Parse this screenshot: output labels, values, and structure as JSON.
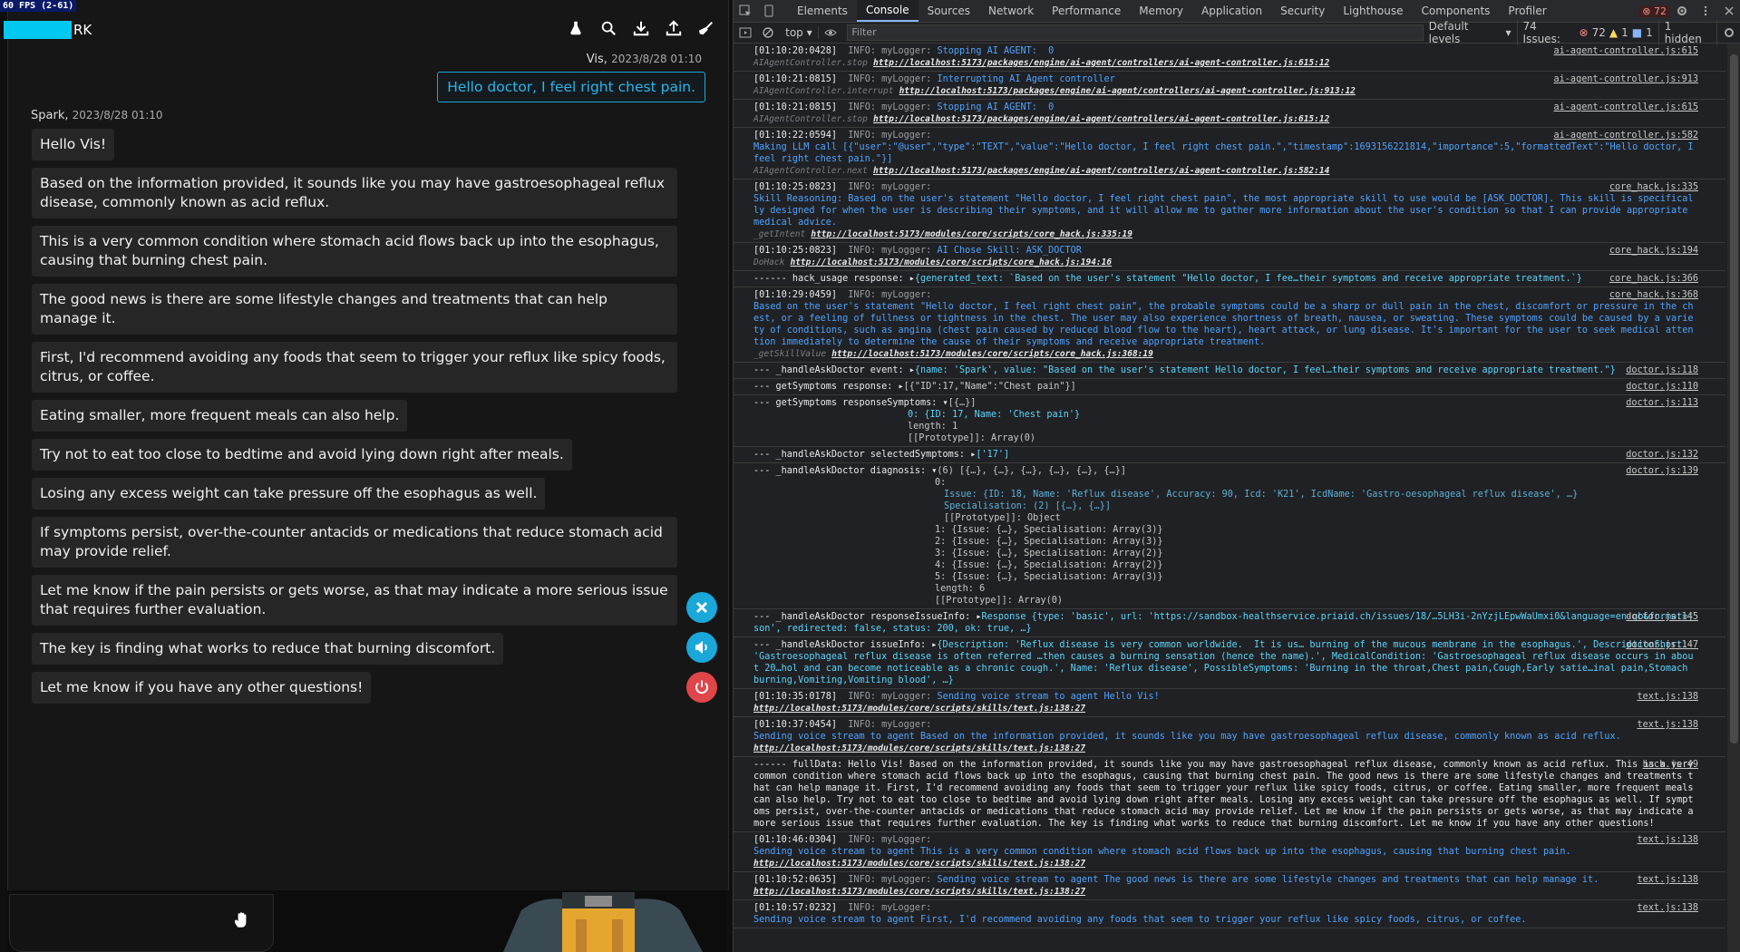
{
  "chat": {
    "fps": "60 FPS (2-61)",
    "brand_suffix": "RK",
    "user_name": "Vis,",
    "user_time": "2023/8/28 01:10",
    "user_message": "Hello doctor, I feel right chest pain.",
    "bot_name": "Spark,",
    "bot_time": "2023/8/28 01:10",
    "messages": [
      "Hello Vis!",
      "Based on the information provided, it sounds like you may have gastroesophageal reflux disease, commonly known as acid reflux.",
      "This is a very common condition where stomach acid flows back up into the esophagus, causing that burning chest pain.",
      "The good news is there are some lifestyle changes and treatments that can help manage it.",
      "First, I'd recommend avoiding any foods that seem to trigger your reflux like spicy foods, citrus, or coffee.",
      "Eating smaller, more frequent meals can also help.",
      "Try not to eat too close to bedtime and avoid lying down right after meals.",
      "Losing any excess weight can take pressure off the esophagus as well.",
      "If symptoms persist, over-the-counter antacids or medications that reduce stomach acid may provide relief.",
      "Let me know if the pain persists or gets worse, as that may indicate a more serious issue that requires further evaluation.",
      "The key is finding what works to reduce that burning discomfort.",
      "Let me know if you have any other questions!"
    ],
    "icons": [
      "flask-icon",
      "search-icon",
      "download-icon",
      "upload-icon",
      "broom-icon"
    ],
    "colors": {
      "accent": "#1fa8d6",
      "close_fab": "#1aa7d9",
      "sound_fab": "#1aa7d9",
      "power_fab": "#e0454a"
    }
  },
  "devtools": {
    "tabs": [
      "Elements",
      "Console",
      "Sources",
      "Network",
      "Performance",
      "Memory",
      "Application",
      "Security",
      "Lighthouse",
      "Components",
      "Profiler"
    ],
    "active_tab": "Console",
    "error_count": "72",
    "context": "top",
    "filter_placeholder": "Filter",
    "levels": "Default levels",
    "issues_label": "74 Issues:",
    "issues_err": "72",
    "issues_warn": "1",
    "issues_info": "1",
    "hidden": "1 hidden",
    "logs": [
      {
        "ts": "[01:10:20:0428]",
        "tag": "INFO:",
        "logger": "myLogger:",
        "msg": "Stopping AI AGENT:  0",
        "stack": "AIAgentController.stop",
        "url": "http://localhost:5173/packages/engine/ai-agent/controllers/ai-agent-controller.js:615:12",
        "src": "ai-agent-controller.js:615"
      },
      {
        "ts": "[01:10:21:0815]",
        "tag": "INFO:",
        "logger": "myLogger:",
        "msg": "Interrupting AI Agent controller",
        "stack": "AIAgentController.interrupt",
        "url": "http://localhost:5173/packages/engine/ai-agent/controllers/ai-agent-controller.js:913:12",
        "src": "ai-agent-controller.js:913"
      },
      {
        "ts": "[01:10:21:0815]",
        "tag": "INFO:",
        "logger": "myLogger:",
        "msg": "Stopping AI AGENT:  0",
        "stack": "AIAgentController.stop",
        "url": "http://localhost:5173/packages/engine/ai-agent/controllers/ai-agent-controller.js:615:12",
        "src": "ai-agent-controller.js:615"
      },
      {
        "ts": "[01:10:22:0594]",
        "tag": "INFO:",
        "logger": "myLogger:",
        "msg": "Making LLM call [{\"user\":\"@user\",\"type\":\"TEXT\",\"value\":\"Hello doctor, I feel right chest pain.\",\"timestamp\":1693156221814,\"importance\":5,\"formattedText\":\"Hello doctor, I feel right chest pain.\"}]",
        "stack": "AIAgentController.next",
        "url": "http://localhost:5173/packages/engine/ai-agent/controllers/ai-agent-controller.js:582:14",
        "src": "ai-agent-controller.js:582"
      },
      {
        "ts": "[01:10:25:0823]",
        "tag": "INFO:",
        "logger": "myLogger:",
        "msg": "Skill Reasoning: Based on the user's statement \"Hello doctor, I feel right chest pain\", the most appropriate skill to use would be [ASK_DOCTOR]. This skill is specifically designed for when the user is describing their symptoms, and it will allow me to gather more information about the user's condition so that I can provide appropriate medical advice.",
        "stack": "_getIntent",
        "url": "http://localhost:5173/modules/core/scripts/core_hack.js:335:19",
        "src": "core_hack.js:335"
      },
      {
        "ts": "[01:10:25:0823]",
        "tag": "INFO:",
        "logger": "myLogger:",
        "msg": "AI Chose Skill: ASK_DOCTOR",
        "stack": "DoHack",
        "url": "http://localhost:5173/modules/core/scripts/core_hack.js:194:16",
        "src": "core_hack.js:194"
      }
    ],
    "hack_usage": {
      "label": "------ hack_usage response:",
      "value": "{generated_text: `Based on the user's statement \"Hello doctor, I fee…their symptoms and receive appropriate treatment.`}",
      "src": "core_hack.js:366"
    },
    "log_29": {
      "ts": "[01:10:29:0459]",
      "tag": "INFO:",
      "logger": "myLogger:",
      "msg": "Based on the user's statement \"Hello doctor, I feel right chest pain\", the probable symptoms could be a sharp or dull pain in the chest, discomfort or pressure in the chest, or a feeling of fullness or tightness in the chest. The user may also experience shortness of breath, nausea, or sweating. These symptoms could be caused by a variety of conditions, such as angina (chest pain caused by reduced blood flow to the heart), heart attack, or lung disease. It's important for the user to seek medical attention immediately to determine the cause of their symptoms and receive appropriate treatment.",
      "stack": "_getSkillValue",
      "url": "http://localhost:5173/modules/core/scripts/core_hack.js:368:19",
      "src": "core_hack.js:368"
    },
    "ask_event": {
      "label": "--- _handleAskDoctor event:",
      "value": "{name: 'Spark', value: \"Based on the user's statement Hello doctor, I feel…their symptoms and receive appropriate treatment.\"}",
      "src": "doctor.js:118"
    },
    "get_symptoms": {
      "label": "--- getSymptoms response:",
      "value": "[{\"ID\":17,\"Name\":\"Chest pain\"}]",
      "src": "doctor.js:110"
    },
    "response_symptoms": {
      "label": "--- getSymptoms responseSymptoms:",
      "head": "[{…}]",
      "item0": "0: {ID: 17, Name: 'Chest pain'}",
      "length": "length: 1",
      "proto": "[[Prototype]]: Array(0)",
      "src": "doctor.js:113"
    },
    "selected_symptoms": {
      "label": "--- _handleAskDoctor selectedSymptoms:",
      "value": "['17']",
      "src": "doctor.js:132"
    },
    "diagnosis": {
      "label": "--- _handleAskDoctor diagnosis:",
      "head": "(6) [{…}, {…}, {…}, {…}, {…}, {…}]",
      "src": "doctor.js:139",
      "lines": [
        "0:",
        "Issue: {ID: 18, Name: 'Reflux disease', Accuracy: 90, Icd: 'K21', IcdName: 'Gastro-oesophageal reflux disease', …}",
        "Specialisation: (2) [{…}, {…}]",
        "[[Prototype]]: Object",
        "1: {Issue: {…}, Specialisation: Array(3)}",
        "2: {Issue: {…}, Specialisation: Array(3)}",
        "3: {Issue: {…}, Specialisation: Array(2)}",
        "4: {Issue: {…}, Specialisation: Array(2)}",
        "5: {Issue: {…}, Specialisation: Array(3)}",
        "length: 6",
        "[[Prototype]]: Array(0)"
      ]
    },
    "issue_info_resp": {
      "label": "--- _handleAskDoctor responseIssueInfo:",
      "value": "Response {type: 'basic', url: 'https://sandbox-healthservice.priaid.ch/issues/18/…5LH3i-2nYzjLEpwWaUmxi0&language=en-gb&format=json', redirected: false, status: 200, ok: true, …}",
      "src": "doctor.js:145"
    },
    "issue_info": {
      "label": "--- _handleAskDoctor issueInfo:",
      "value": "{Description: 'Reflux disease is very common worldwide.  It is us… burning of the mucous membrane in the esophagus.', DescriptionShort: 'Gastroesophageal reflux disease is often referred …then causes a burning sensation (hence the name).', MedicalCondition: 'Gastroesophageal reflux disease occurs in about 20…hol and can become noticeable as a chronic cough.', Name: 'Reflux disease', PossibleSymptoms: 'Burning in the throat,Chest pain,Cough,Early satie…inal pain,Stomach burning,Vomiting,Vomiting blood', …}",
      "src": "doctor.js:147"
    },
    "log_35": {
      "ts": "[01:10:35:0178]",
      "tag": "INFO:",
      "logger": "myLogger:",
      "msg": "Sending voice stream to agent Hello Vis!",
      "url": "http://localhost:5173/modules/core/scripts/skills/text.js:138:27",
      "src": "text.js:138"
    },
    "log_37": {
      "ts": "[01:10:37:0454]",
      "tag": "INFO:",
      "logger": "myLogger:",
      "msg": "Sending voice stream to agent Based on the information provided, it sounds like you may have gastroesophageal reflux disease, commonly known as acid reflux.",
      "url": "http://localhost:5173/modules/core/scripts/skills/text.js:138:27",
      "src": "text.js:138"
    },
    "full_data": {
      "label": "------ fullData:",
      "value": "Hello Vis! Based on the information provided, it sounds like you may have gastroesophageal reflux disease, commonly known as acid reflux. This is a very common condition where stomach acid flows back up into the esophagus, causing that burning chest pain. The good news is there are some lifestyle changes and treatments that can help manage it. First, I'd recommend avoiding any foods that seem to trigger your reflux like spicy foods, citrus, or coffee. Eating smaller, more frequent meals can also help. Try not to eat too close to bedtime and avoid lying down right after meals. Losing any excess weight can take pressure off the esophagus as well. If symptoms persist, over-the-counter antacids or medications that reduce stomach acid may provide relief. Let me know if the pain persists or gets worse, as that may indicate a more serious issue that requires further evaluation. The key is finding what works to reduce that burning discomfort. Let me know if you have any other questions!",
      "src": "hack.js:49"
    },
    "log_46": {
      "ts": "[01:10:46:0304]",
      "tag": "INFO:",
      "logger": "myLogger:",
      "msg": "Sending voice stream to agent This is a very common condition where stomach acid flows back up into the esophagus, causing that burning chest pain.",
      "url": "http://localhost:5173/modules/core/scripts/skills/text.js:138:27",
      "src": "text.js:138"
    },
    "log_52": {
      "ts": "[01:10:52:0635]",
      "tag": "INFO:",
      "logger": "myLogger:",
      "msg": "Sending voice stream to agent The good news is there are some lifestyle changes and treatments that can help manage it.",
      "url": "http://localhost:5173/modules/core/scripts/skills/text.js:138:27",
      "src": "text.js:138"
    },
    "log_57": {
      "ts": "[01:10:57:0232]",
      "tag": "INFO:",
      "logger": "myLogger:",
      "msg": "Sending voice stream to agent First, I'd recommend avoiding any foods that seem to trigger your reflux like spicy foods, citrus, or coffee.",
      "src": "text.js:138"
    }
  }
}
